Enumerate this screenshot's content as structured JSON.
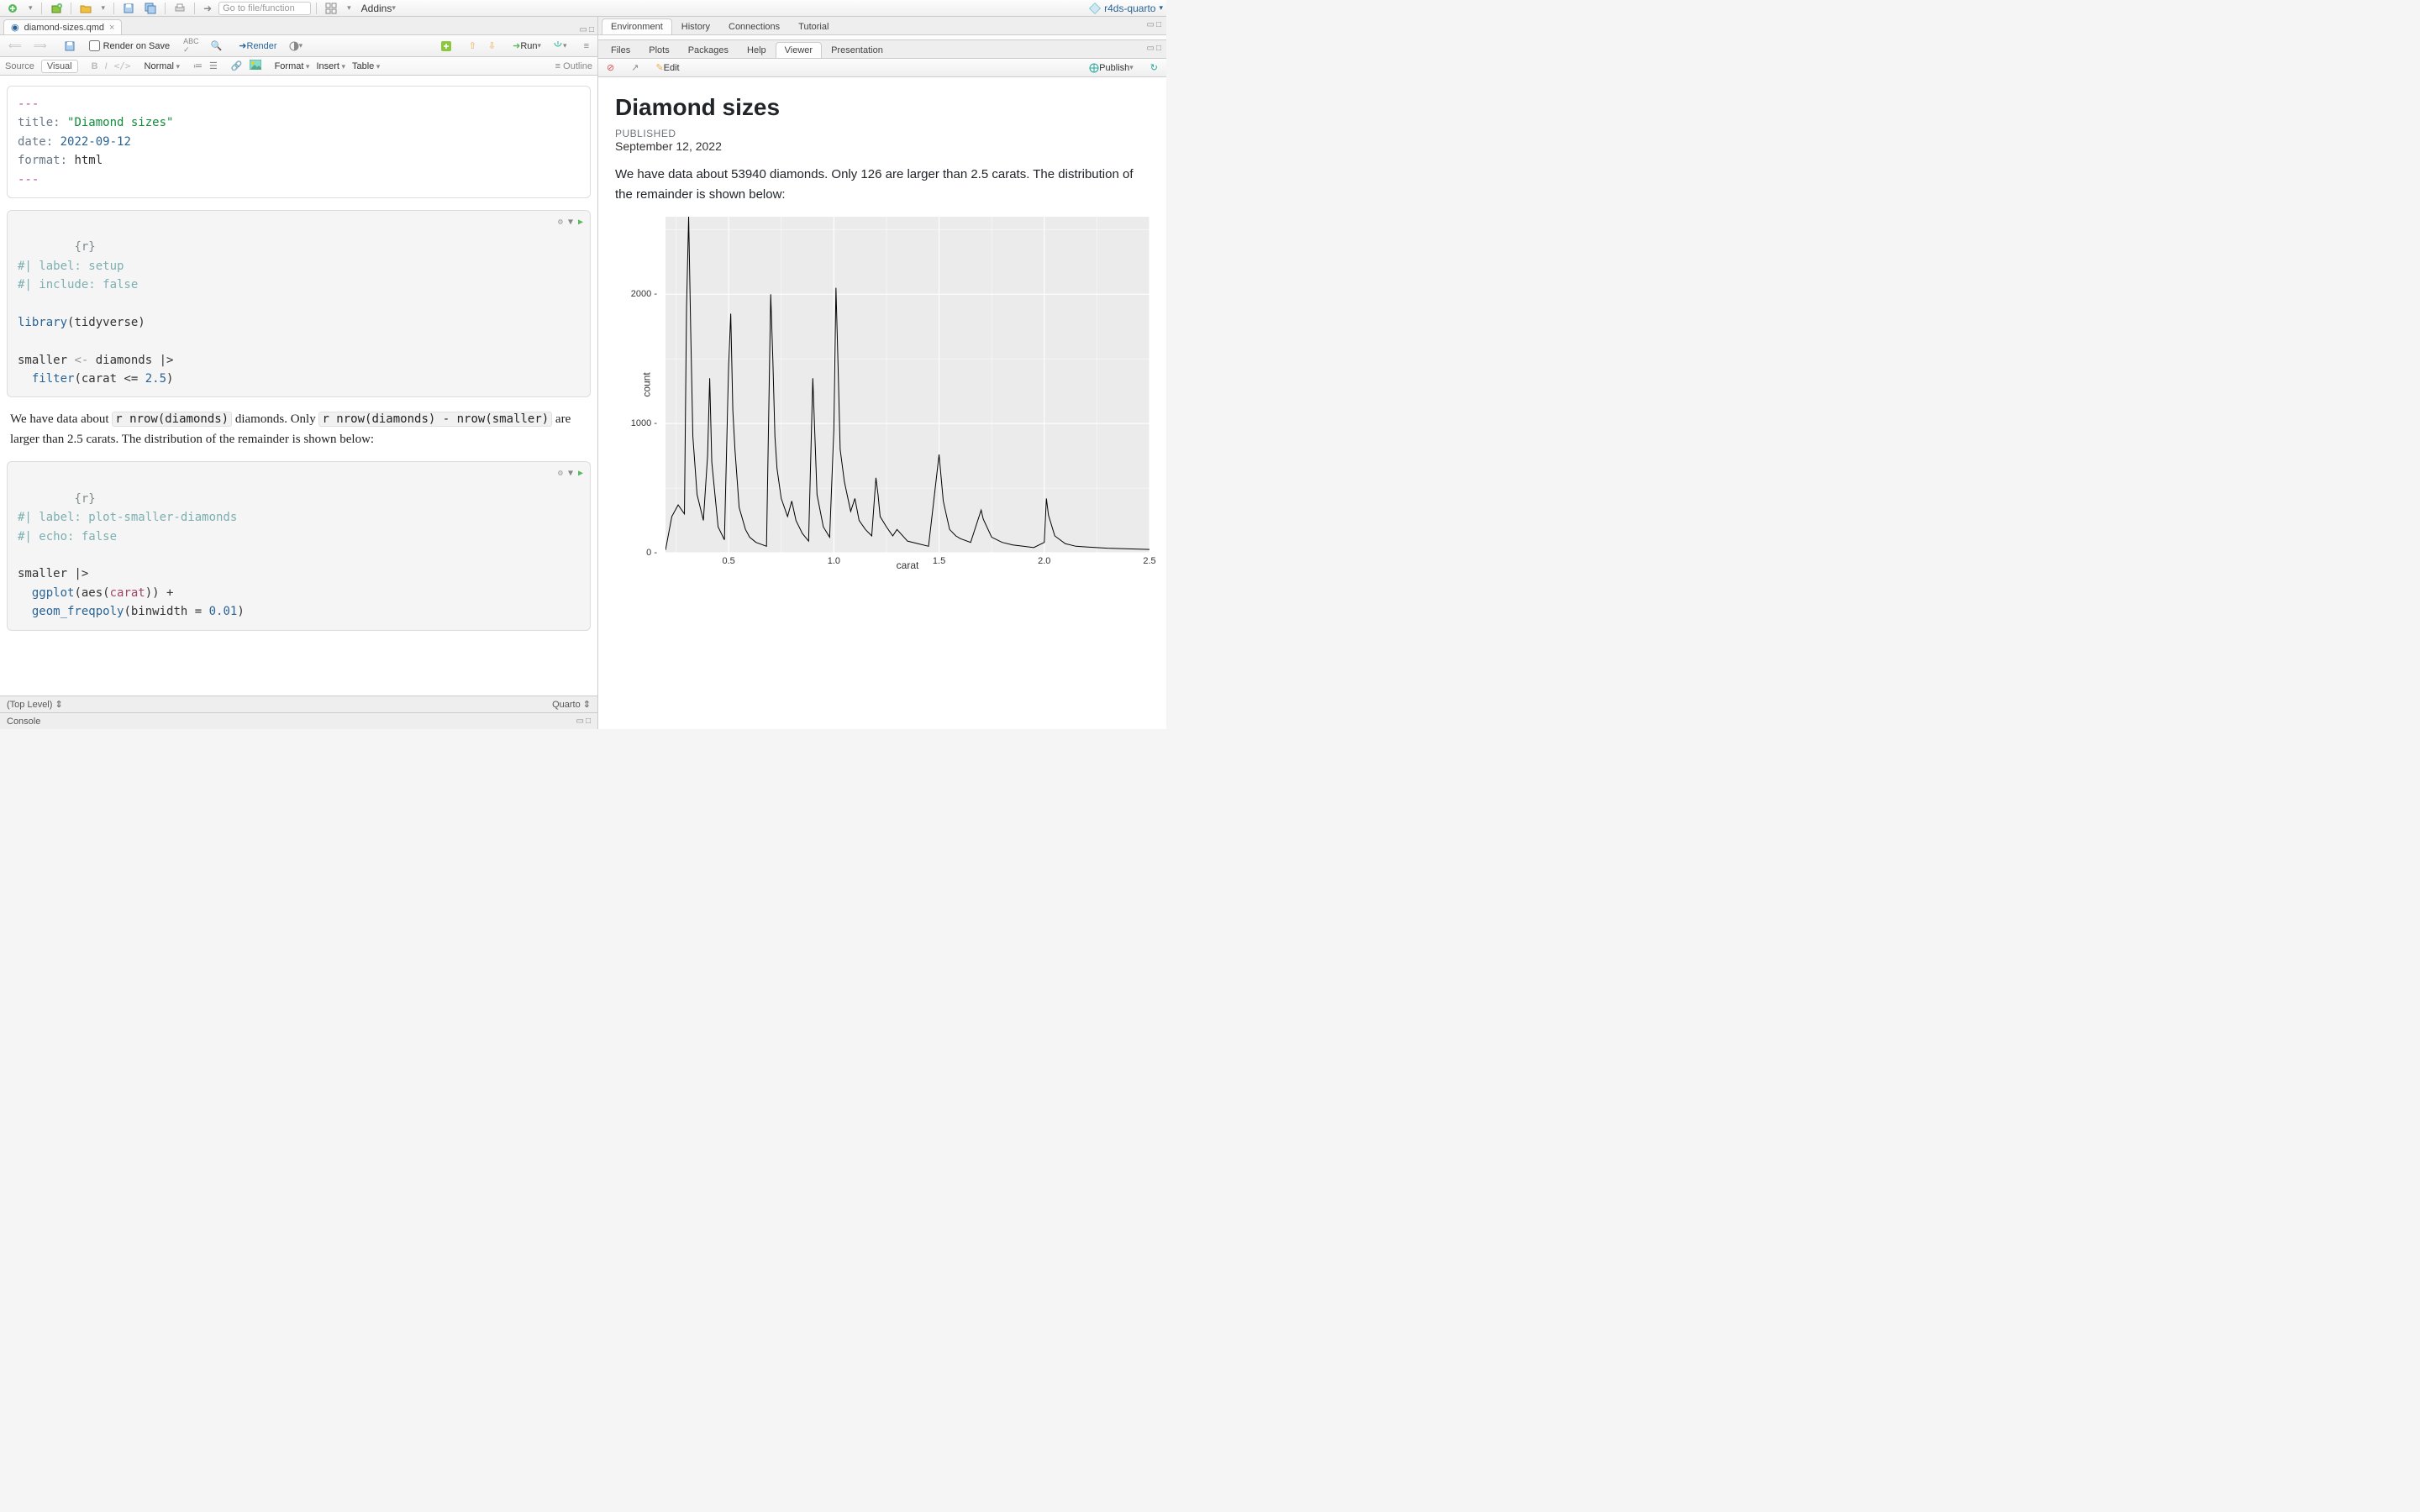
{
  "toolbar": {
    "goto_placeholder": "Go to file/function",
    "addins": "Addins"
  },
  "project": {
    "name": "r4ds-quarto"
  },
  "editor": {
    "tab": "diamond-sizes.qmd",
    "render_on_save": "Render on Save",
    "render": "Render",
    "run": "Run",
    "source_tab": "Source",
    "visual_tab": "Visual",
    "normal": "Normal",
    "format": "Format",
    "insert": "Insert",
    "table": "Table",
    "outline": "Outline",
    "yaml": {
      "dashes": "---",
      "title_key": "title:",
      "title_val": "\"Diamond sizes\"",
      "date_key": "date:",
      "date_val": "2022-09-12",
      "format_key": "format:",
      "format_val": "html"
    },
    "chunk1": {
      "open": "{r}",
      "l1": "#| label: setup",
      "l2": "#| include: false",
      "lib": "library",
      "libarg": "(tidyverse)",
      "assign_lhs": "smaller",
      "assign_op": " <- ",
      "assign_rhs": "diamonds |>",
      "filter": "  filter",
      "filter_arg_l": "(carat <= ",
      "filter_num": "2.5",
      "filter_arg_r": ")"
    },
    "prose": {
      "p1": "We have data about ",
      "i1": "r nrow(diamonds)",
      "p2": " diamonds. Only ",
      "i2": "r nrow(diamonds) - nrow(smaller)",
      "p3": " are larger than 2.5 carats. The distribution of the remainder is shown below:"
    },
    "chunk2": {
      "open": "{r}",
      "l1": "#| label: plot-smaller-diamonds",
      "l2": "#| echo: false",
      "pipe": "smaller |>",
      "gg": "  ggplot",
      "gg_args": "(aes(",
      "gg_var": "carat",
      "gg_args2": ")) +",
      "geom": "  geom_freqpoly",
      "geom_args": "(binwidth = ",
      "bw": "0.01",
      "geom_args2": ")"
    },
    "status": {
      "toplevel": "(Top Level)",
      "lang": "Quarto"
    },
    "console": "Console"
  },
  "right": {
    "top_tabs": [
      "Environment",
      "History",
      "Connections",
      "Tutorial"
    ],
    "bottom_tabs": [
      "Files",
      "Plots",
      "Packages",
      "Help",
      "Viewer",
      "Presentation"
    ],
    "edit": "Edit",
    "publish": "Publish",
    "doc": {
      "title": "Diamond sizes",
      "pub_label": "PUBLISHED",
      "pub_date": "September 12, 2022",
      "body": "We have data about 53940 diamonds. Only 126 are larger than 2.5 carats. The distribution of the remainder is shown below:"
    }
  },
  "chart_data": {
    "type": "line",
    "xlabel": "carat",
    "ylabel": "count",
    "xlim": [
      0.2,
      2.5
    ],
    "ylim": [
      0,
      2600
    ],
    "xticks": [
      0.5,
      1.0,
      1.5,
      2.0,
      2.5
    ],
    "yticks": [
      0,
      1000,
      2000
    ],
    "x": [
      0.2,
      0.23,
      0.26,
      0.29,
      0.3,
      0.31,
      0.32,
      0.33,
      0.35,
      0.38,
      0.4,
      0.41,
      0.42,
      0.45,
      0.48,
      0.5,
      0.51,
      0.52,
      0.53,
      0.55,
      0.58,
      0.6,
      0.63,
      0.68,
      0.7,
      0.71,
      0.72,
      0.73,
      0.75,
      0.78,
      0.8,
      0.82,
      0.85,
      0.88,
      0.9,
      0.91,
      0.92,
      0.95,
      0.98,
      1.0,
      1.01,
      1.02,
      1.03,
      1.05,
      1.08,
      1.1,
      1.12,
      1.15,
      1.18,
      1.2,
      1.21,
      1.22,
      1.25,
      1.28,
      1.3,
      1.35,
      1.4,
      1.45,
      1.5,
      1.51,
      1.52,
      1.55,
      1.58,
      1.6,
      1.65,
      1.7,
      1.71,
      1.75,
      1.8,
      1.85,
      1.9,
      1.95,
      2.0,
      2.01,
      2.02,
      2.05,
      2.1,
      2.15,
      2.2,
      2.3,
      2.4,
      2.5
    ],
    "y": [
      20,
      280,
      370,
      300,
      1900,
      2600,
      1700,
      900,
      450,
      250,
      750,
      1350,
      700,
      200,
      100,
      1450,
      1850,
      1100,
      800,
      350,
      180,
      120,
      80,
      50,
      2000,
      1500,
      900,
      650,
      420,
      280,
      400,
      250,
      150,
      90,
      1350,
      900,
      450,
      200,
      120,
      950,
      2050,
      1450,
      800,
      550,
      320,
      420,
      250,
      180,
      130,
      580,
      450,
      280,
      200,
      130,
      180,
      90,
      70,
      50,
      760,
      580,
      400,
      180,
      130,
      110,
      80,
      330,
      260,
      120,
      80,
      60,
      50,
      40,
      80,
      420,
      290,
      130,
      70,
      50,
      45,
      35,
      30,
      25
    ]
  }
}
